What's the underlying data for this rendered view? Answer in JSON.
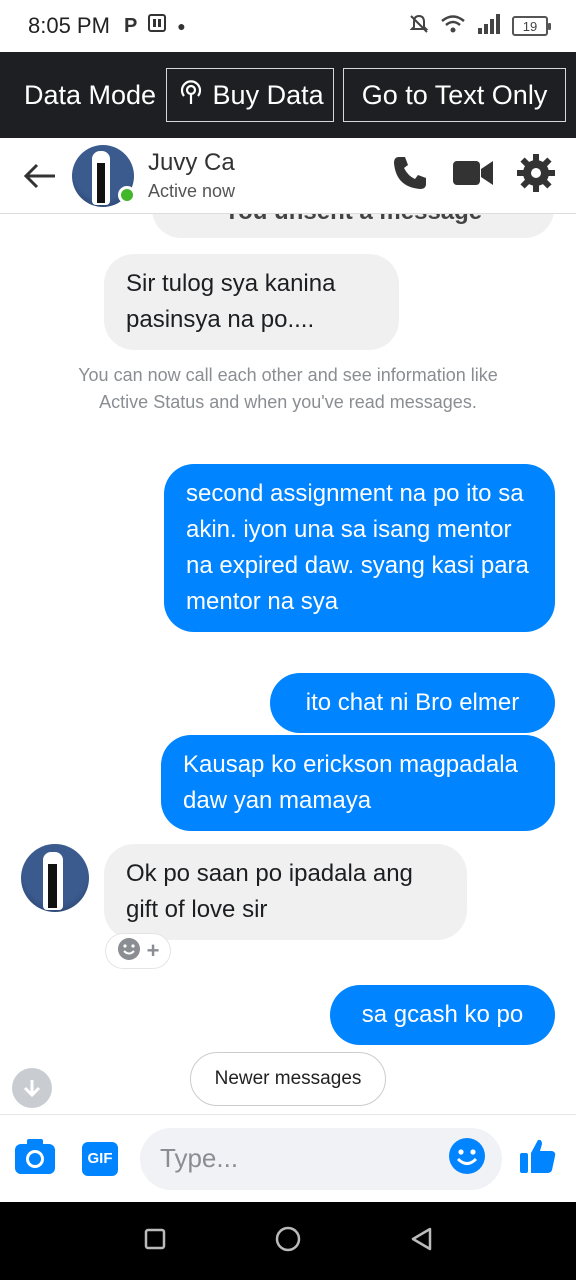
{
  "status_bar": {
    "time": "8:05 PM",
    "left_icons": [
      "p-icon",
      "sim-icon",
      "dot-icon"
    ],
    "battery": "19"
  },
  "data_bar": {
    "mode_label": "Data Mode",
    "buy_label": "Buy Data",
    "text_only_label": "Go to Text Only"
  },
  "header": {
    "contact_name": "Juvy Ca",
    "status": "Active now"
  },
  "messages": {
    "partial_top": "You unsent a message",
    "m1": "Sir  tulog  sya kanina pasinsya  na po....",
    "system_note": "You can now call each other and see information like Active Status and when you've read messages.",
    "m2": "second assignment na po ito sa akin. iyon una sa isang mentor na expired daw. syang kasi para mentor na sya",
    "m3": "ito chat ni Bro elmer",
    "m4": "Kausap ko erickson magpadala daw yan mamaya",
    "m5": "Ok po saan  po ipadala ang gift of love sir",
    "m6": "sa gcash ko po"
  },
  "newer_messages_label": "Newer messages",
  "composer": {
    "placeholder": "Type...",
    "gif_label": "GIF"
  },
  "colors": {
    "accent": "#0084ff",
    "incoming_bubble": "#f0f0f0",
    "data_bar_bg": "#1d1f22",
    "online": "#42b72a"
  }
}
